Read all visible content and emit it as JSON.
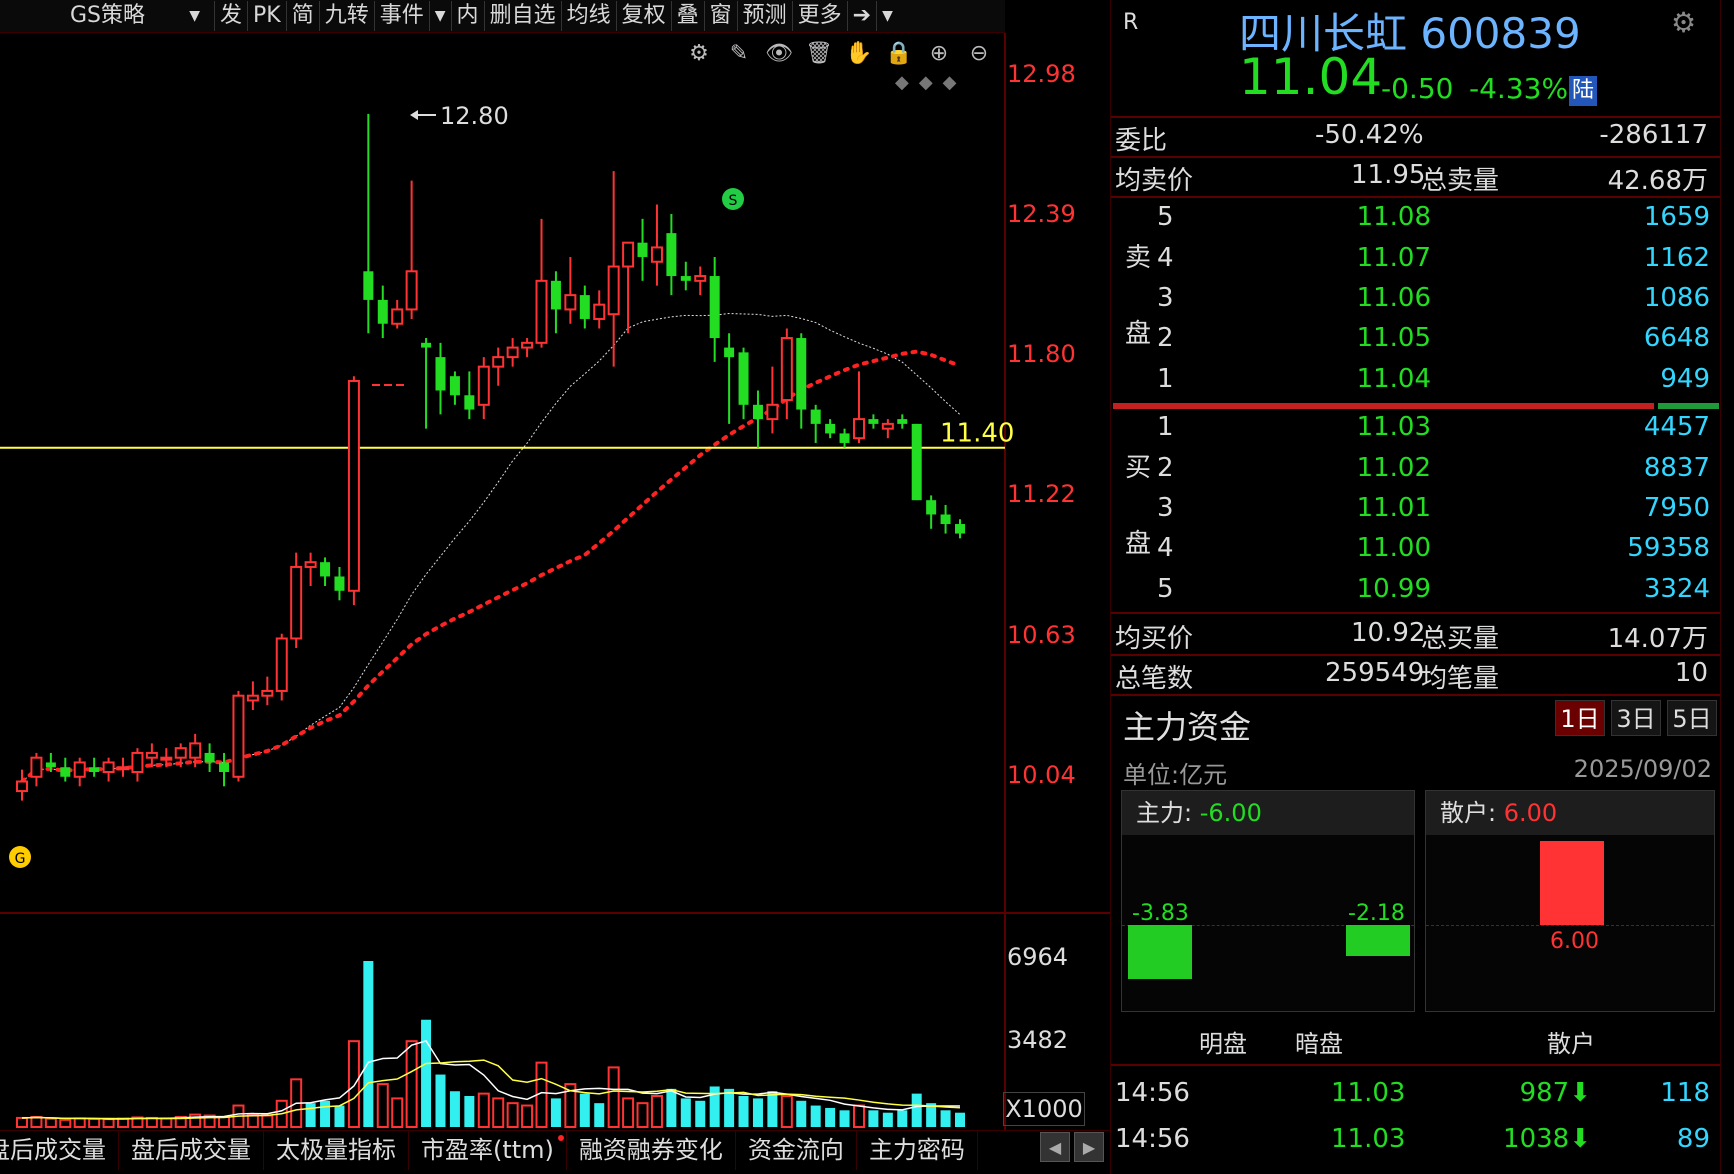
{
  "toolbar": {
    "strategy": "GS策略",
    "items": [
      "发",
      "PK",
      "简",
      "九转",
      "事件",
      "▼",
      "内",
      "删自选",
      "均线",
      "复权",
      "叠",
      "窗",
      "预测",
      "更多"
    ]
  },
  "chart": {
    "price_axis": [
      "12.98",
      "12.39",
      "11.80",
      "11.22",
      "10.63",
      "10.04"
    ],
    "high_label": "12.80",
    "hline_label": "11.40",
    "vol_axis": [
      "6964",
      "3482"
    ],
    "vol_unit": "X1000"
  },
  "chart_data": {
    "type": "candlestick",
    "hline": 11.4,
    "high_marker": 12.8,
    "ohlc": [
      [
        9.96,
        10.05,
        9.92,
        10.0
      ],
      [
        10.02,
        10.12,
        9.98,
        10.1
      ],
      [
        10.08,
        10.12,
        10.04,
        10.06
      ],
      [
        10.06,
        10.1,
        10.0,
        10.02
      ],
      [
        10.02,
        10.1,
        9.98,
        10.08
      ],
      [
        10.06,
        10.1,
        10.02,
        10.04
      ],
      [
        10.04,
        10.1,
        10.0,
        10.08
      ],
      [
        10.06,
        10.1,
        10.02,
        10.06
      ],
      [
        10.04,
        10.14,
        10.0,
        10.12
      ],
      [
        10.1,
        10.16,
        10.06,
        10.12
      ],
      [
        10.1,
        10.14,
        10.06,
        10.1
      ],
      [
        10.1,
        10.16,
        10.06,
        10.14
      ],
      [
        10.1,
        10.2,
        10.06,
        10.16
      ],
      [
        10.12,
        10.16,
        10.04,
        10.08
      ],
      [
        10.08,
        10.12,
        9.98,
        10.04
      ],
      [
        10.02,
        10.38,
        10.0,
        10.36
      ],
      [
        10.34,
        10.42,
        10.3,
        10.36
      ],
      [
        10.36,
        10.44,
        10.32,
        10.38
      ],
      [
        10.38,
        10.62,
        10.34,
        10.6
      ],
      [
        10.6,
        10.96,
        10.56,
        10.9
      ],
      [
        10.9,
        10.96,
        10.82,
        10.92
      ],
      [
        10.92,
        10.94,
        10.82,
        10.86
      ],
      [
        10.86,
        10.9,
        10.76,
        10.8
      ],
      [
        10.8,
        11.7,
        10.74,
        11.68
      ],
      [
        12.14,
        12.8,
        11.88,
        12.02
      ],
      [
        12.02,
        12.08,
        11.86,
        11.92
      ],
      [
        11.92,
        12.02,
        11.9,
        11.98
      ],
      [
        11.98,
        12.52,
        11.94,
        12.14
      ],
      [
        11.84,
        11.86,
        11.48,
        11.82
      ],
      [
        11.78,
        11.84,
        11.54,
        11.64
      ],
      [
        11.7,
        11.72,
        11.58,
        11.62
      ],
      [
        11.62,
        11.72,
        11.52,
        11.56
      ],
      [
        11.58,
        11.78,
        11.52,
        11.74
      ],
      [
        11.74,
        11.82,
        11.66,
        11.78
      ],
      [
        11.78,
        11.86,
        11.74,
        11.82
      ],
      [
        11.82,
        11.86,
        11.78,
        11.84
      ],
      [
        11.84,
        12.36,
        11.82,
        12.1
      ],
      [
        12.1,
        12.14,
        11.88,
        11.98
      ],
      [
        11.98,
        12.2,
        11.92,
        12.04
      ],
      [
        12.04,
        12.08,
        11.9,
        11.94
      ],
      [
        11.94,
        12.06,
        11.9,
        12.0
      ],
      [
        11.96,
        12.56,
        11.74,
        12.16
      ],
      [
        12.16,
        12.22,
        11.88,
        12.26
      ],
      [
        12.26,
        12.36,
        12.1,
        12.2
      ],
      [
        12.18,
        12.42,
        12.08,
        12.24
      ],
      [
        12.3,
        12.38,
        12.04,
        12.12
      ],
      [
        12.12,
        12.18,
        12.06,
        12.1
      ],
      [
        12.1,
        12.16,
        12.04,
        12.12
      ],
      [
        12.12,
        12.2,
        11.76,
        11.86
      ],
      [
        11.82,
        11.88,
        11.5,
        11.78
      ],
      [
        11.8,
        11.82,
        11.52,
        11.58
      ],
      [
        11.58,
        11.64,
        11.4,
        11.52
      ],
      [
        11.52,
        11.74,
        11.46,
        11.58
      ],
      [
        11.6,
        11.9,
        11.52,
        11.86
      ],
      [
        11.86,
        11.88,
        11.48,
        11.56
      ],
      [
        11.56,
        11.58,
        11.42,
        11.5
      ],
      [
        11.5,
        11.52,
        11.44,
        11.46
      ],
      [
        11.46,
        11.48,
        11.4,
        11.42
      ],
      [
        11.44,
        11.72,
        11.42,
        11.52
      ],
      [
        11.52,
        11.54,
        11.48,
        11.5
      ],
      [
        11.48,
        11.52,
        11.44,
        11.5
      ],
      [
        11.52,
        11.54,
        11.48,
        11.5
      ],
      [
        11.5,
        11.5,
        11.18,
        11.18
      ],
      [
        11.18,
        11.2,
        11.06,
        11.12
      ],
      [
        11.12,
        11.16,
        11.04,
        11.08
      ],
      [
        11.08,
        11.1,
        11.02,
        11.04
      ]
    ],
    "volume": [
      {
        "v": 380,
        "c": "r"
      },
      {
        "v": 420,
        "c": "r"
      },
      {
        "v": 350,
        "c": "r"
      },
      {
        "v": 300,
        "c": "r"
      },
      {
        "v": 360,
        "c": "r"
      },
      {
        "v": 340,
        "c": "r"
      },
      {
        "v": 330,
        "c": "r"
      },
      {
        "v": 350,
        "c": "r"
      },
      {
        "v": 400,
        "c": "r"
      },
      {
        "v": 380,
        "c": "r"
      },
      {
        "v": 360,
        "c": "r"
      },
      {
        "v": 420,
        "c": "r"
      },
      {
        "v": 520,
        "c": "r"
      },
      {
        "v": 480,
        "c": "r"
      },
      {
        "v": 420,
        "c": "r"
      },
      {
        "v": 900,
        "c": "r"
      },
      {
        "v": 500,
        "c": "r"
      },
      {
        "v": 480,
        "c": "r"
      },
      {
        "v": 1100,
        "c": "r"
      },
      {
        "v": 2000,
        "c": "r"
      },
      {
        "v": 1000,
        "c": "c"
      },
      {
        "v": 1100,
        "c": "c"
      },
      {
        "v": 900,
        "c": "c"
      },
      {
        "v": 3600,
        "c": "r"
      },
      {
        "v": 6964,
        "c": "c"
      },
      {
        "v": 1800,
        "c": "r"
      },
      {
        "v": 1200,
        "c": "r"
      },
      {
        "v": 3600,
        "c": "r"
      },
      {
        "v": 4500,
        "c": "c"
      },
      {
        "v": 2200,
        "c": "c"
      },
      {
        "v": 1500,
        "c": "c"
      },
      {
        "v": 1300,
        "c": "c"
      },
      {
        "v": 1400,
        "c": "r"
      },
      {
        "v": 1200,
        "c": "r"
      },
      {
        "v": 1000,
        "c": "r"
      },
      {
        "v": 900,
        "c": "r"
      },
      {
        "v": 2700,
        "c": "r"
      },
      {
        "v": 1200,
        "c": "c"
      },
      {
        "v": 1800,
        "c": "r"
      },
      {
        "v": 1400,
        "c": "c"
      },
      {
        "v": 1000,
        "c": "c"
      },
      {
        "v": 2500,
        "c": "r"
      },
      {
        "v": 1200,
        "c": "r"
      },
      {
        "v": 1000,
        "c": "r"
      },
      {
        "v": 1300,
        "c": "r"
      },
      {
        "v": 1600,
        "c": "c"
      },
      {
        "v": 1200,
        "c": "c"
      },
      {
        "v": 1100,
        "c": "c"
      },
      {
        "v": 1700,
        "c": "c"
      },
      {
        "v": 1600,
        "c": "c"
      },
      {
        "v": 1300,
        "c": "c"
      },
      {
        "v": 1200,
        "c": "c"
      },
      {
        "v": 1500,
        "c": "c"
      },
      {
        "v": 1300,
        "c": "r"
      },
      {
        "v": 1100,
        "c": "c"
      },
      {
        "v": 900,
        "c": "c"
      },
      {
        "v": 800,
        "c": "c"
      },
      {
        "v": 700,
        "c": "c"
      },
      {
        "v": 900,
        "c": "r"
      },
      {
        "v": 700,
        "c": "c"
      },
      {
        "v": 600,
        "c": "c"
      },
      {
        "v": 700,
        "c": "c"
      },
      {
        "v": 1400,
        "c": "c"
      },
      {
        "v": 1000,
        "c": "c"
      },
      {
        "v": 700,
        "c": "c"
      },
      {
        "v": 600,
        "c": "c"
      }
    ]
  },
  "quote": {
    "market_flag": "R",
    "name": "四川长虹 600839",
    "last": "11.04",
    "change": "-0.50",
    "change_pct": "-4.33%",
    "badge": "陆"
  },
  "summary": {
    "weibi_label": "委比",
    "weibi_pct": "-50.42%",
    "weibi_val": "-286117",
    "avg_ask_label": "均卖价",
    "avg_ask": "11.95",
    "total_ask_label": "总卖量",
    "total_ask": "42.68万",
    "avg_bid_label": "均买价",
    "avg_bid": "10.92",
    "total_bid_label": "总买量",
    "total_bid": "14.07万",
    "trades_label": "总笔数",
    "trades": "259549",
    "avg_trade_label": "均笔量",
    "avg_trade": "10"
  },
  "orderbook": {
    "ask_label": [
      "卖",
      "盘"
    ],
    "bid_label": [
      "买",
      "盘"
    ],
    "asks": [
      {
        "lvl": "5",
        "price": "11.08",
        "vol": "1659"
      },
      {
        "lvl": "4",
        "price": "11.07",
        "vol": "1162"
      },
      {
        "lvl": "3",
        "price": "11.06",
        "vol": "1086"
      },
      {
        "lvl": "2",
        "price": "11.05",
        "vol": "6648"
      },
      {
        "lvl": "1",
        "price": "11.04",
        "vol": "949"
      }
    ],
    "bids": [
      {
        "lvl": "1",
        "price": "11.03",
        "vol": "4457"
      },
      {
        "lvl": "2",
        "price": "11.02",
        "vol": "8837"
      },
      {
        "lvl": "3",
        "price": "11.01",
        "vol": "7950"
      },
      {
        "lvl": "4",
        "price": "11.00",
        "vol": "59358"
      },
      {
        "lvl": "5",
        "price": "10.99",
        "vol": "3324"
      }
    ],
    "ratio": 0.9
  },
  "money_flow": {
    "title": "主力资金",
    "periods": [
      "1日",
      "3日",
      "5日"
    ],
    "unit": "单位:亿元",
    "date": "2025/09/02",
    "main_label": "主力:",
    "main_val": "-6.00",
    "retail_label": "散户:",
    "retail_val": "6.00",
    "open_val": "-3.83",
    "dark_val": "-2.18",
    "retail_bar_val": "6.00",
    "x_labels": [
      "明盘",
      "暗盘",
      "散户"
    ]
  },
  "ticks": [
    {
      "time": "14:56",
      "price": "11.03",
      "vol": "987",
      "cnt": "118"
    },
    {
      "time": "14:56",
      "price": "11.03",
      "vol": "1038",
      "cnt": "89"
    }
  ],
  "bottom_tabs": [
    "盘后成交量",
    "盘后成交量",
    "太极量指标",
    "市盈率(ttm)",
    "融资融券变化",
    "资金流向",
    "主力密码"
  ],
  "colors": {
    "up": "#ff3333",
    "down": "#22dd22",
    "volume_cyan": "#33f0f0",
    "hline": "#ffff44",
    "ma_red": "#ff2222"
  }
}
